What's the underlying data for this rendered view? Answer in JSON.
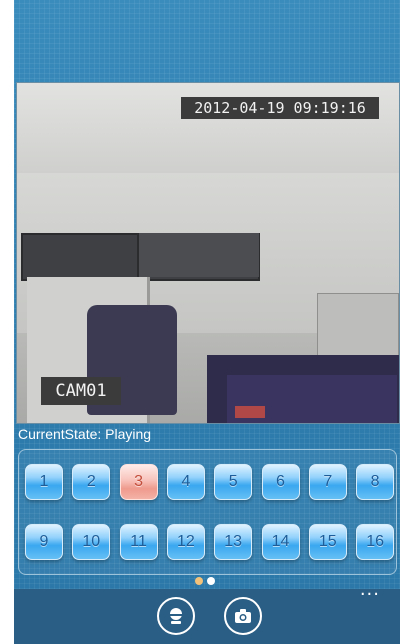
{
  "video": {
    "timestamp": "2012-04-19  09:19:16",
    "camera_label": "CAM01"
  },
  "status": {
    "text": "CurrentState: Playing"
  },
  "channels": {
    "selected": "3",
    "items": [
      "1",
      "2",
      "3",
      "4",
      "5",
      "6",
      "7",
      "8",
      "9",
      "10",
      "11",
      "12",
      "13",
      "14",
      "15",
      "16"
    ]
  },
  "pager": {
    "pages": 2,
    "current": 1,
    "active_color": "#f2c27a",
    "inactive_color": "#ffffff"
  },
  "app_bar": {
    "buttons": [
      {
        "icon": "ptz-camera-icon"
      },
      {
        "icon": "snapshot-camera-icon"
      }
    ],
    "more": "..."
  }
}
